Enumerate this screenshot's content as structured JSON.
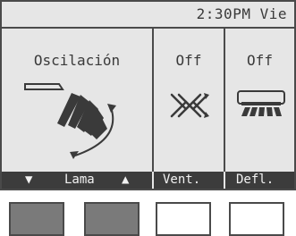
{
  "status_bar": {
    "time": "2:30PM",
    "day": "Vie"
  },
  "panels": {
    "swing": {
      "title": "Oscilación",
      "icon": "swing-vane-icon"
    },
    "vent": {
      "title": "Off",
      "icon": "ventilation-off-icon"
    },
    "deflector": {
      "title": "Off",
      "icon": "air-deflector-icon"
    }
  },
  "softkeys": {
    "down_arrow": "▼",
    "lama_label": "Lama",
    "up_arrow": "▲",
    "vent_label": "Vent.",
    "defl_label": "Defl."
  },
  "colors": {
    "screen_bg": "#e6e6e6",
    "ink": "#3a3a3a",
    "softkey_bar": "#3c3c3c"
  }
}
